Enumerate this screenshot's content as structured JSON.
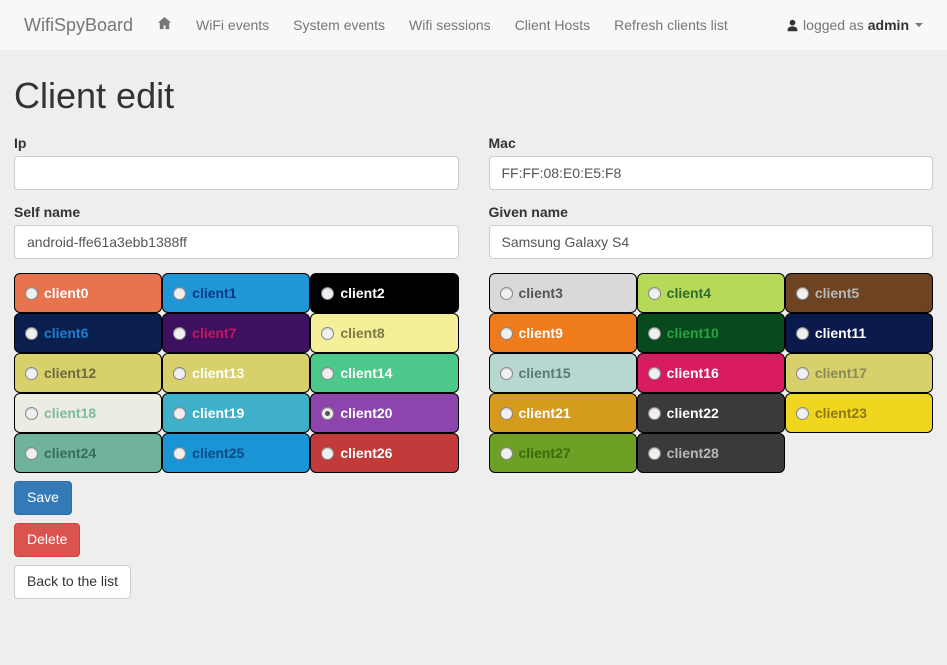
{
  "brand": "WifiSpyBoard",
  "nav": {
    "wifi_events": "WiFi events",
    "system_events": "System events",
    "wifi_sessions": "Wifi sessions",
    "client_hosts": "Client Hosts",
    "refresh": "Refresh clients list"
  },
  "user": {
    "logged_as": "logged as ",
    "name": "admin"
  },
  "page_title": "Client edit",
  "form": {
    "ip_label": "Ip",
    "ip_value": "",
    "mac_label": "Mac",
    "mac_value": "FF:FF:08:E0:E5:F8",
    "self_name_label": "Self name",
    "self_name_value": "android-ffe61a3ebb1388ff",
    "given_name_label": "Given name",
    "given_name_value": "Samsung Galaxy S4"
  },
  "selected_client": "client20",
  "clients": [
    {
      "label": "client0",
      "bg": "#e8734f",
      "fg": "#ffffff"
    },
    {
      "label": "client1",
      "bg": "#2196d6",
      "fg": "#0a3a86"
    },
    {
      "label": "client2",
      "bg": "#000000",
      "fg": "#ffffff"
    },
    {
      "label": "client3",
      "bg": "#d9d9d9",
      "fg": "#555555"
    },
    {
      "label": "client4",
      "bg": "#b6d957",
      "fg": "#2e6b2e"
    },
    {
      "label": "client5",
      "bg": "#6d4321",
      "fg": "#b8b8b8"
    },
    {
      "label": "client6",
      "bg": "#0a1f4d",
      "fg": "#1e7fd1"
    },
    {
      "label": "client7",
      "bg": "#3e1060",
      "fg": "#c2185b"
    },
    {
      "label": "client8",
      "bg": "#f5ef99",
      "fg": "#7a7a46"
    },
    {
      "label": "client9",
      "bg": "#f07b1a",
      "fg": "#ffffff"
    },
    {
      "label": "client10",
      "bg": "#064a1e",
      "fg": "#2ea043"
    },
    {
      "label": "client11",
      "bg": "#0a1a4d",
      "fg": "#ffffff"
    },
    {
      "label": "client12",
      "bg": "#d8d06a",
      "fg": "#6b6b3d"
    },
    {
      "label": "client13",
      "bg": "#d8d06a",
      "fg": "#ffffff"
    },
    {
      "label": "client14",
      "bg": "#4cc98a",
      "fg": "#ffffff"
    },
    {
      "label": "client15",
      "bg": "#b7d7d0",
      "fg": "#5a7a74"
    },
    {
      "label": "client16",
      "bg": "#d81b60",
      "fg": "#ffffff"
    },
    {
      "label": "client17",
      "bg": "#d8d06a",
      "fg": "#8a8a55"
    },
    {
      "label": "client18",
      "bg": "#ecece2",
      "fg": "#7dbb9a"
    },
    {
      "label": "client19",
      "bg": "#3fb0c9",
      "fg": "#ffffff"
    },
    {
      "label": "client20",
      "bg": "#8e44ad",
      "fg": "#ffffff"
    },
    {
      "label": "client21",
      "bg": "#d49b1d",
      "fg": "#ffffff"
    },
    {
      "label": "client22",
      "bg": "#3a3a3a",
      "fg": "#ffffff"
    },
    {
      "label": "client23",
      "bg": "#f1d61f",
      "fg": "#8a7a0f"
    },
    {
      "label": "client24",
      "bg": "#6fb39c",
      "fg": "#3a6b5a"
    },
    {
      "label": "client25",
      "bg": "#1995d6",
      "fg": "#0a4a86"
    },
    {
      "label": "client26",
      "bg": "#c33a3a",
      "fg": "#ffffff"
    },
    {
      "label": "client27",
      "bg": "#6da024",
      "fg": "#3a6b0f"
    },
    {
      "label": "client28",
      "bg": "#3a3a3a",
      "fg": "#b8b8b8"
    }
  ],
  "buttons": {
    "save": "Save",
    "delete": "Delete",
    "back": "Back to the list"
  }
}
